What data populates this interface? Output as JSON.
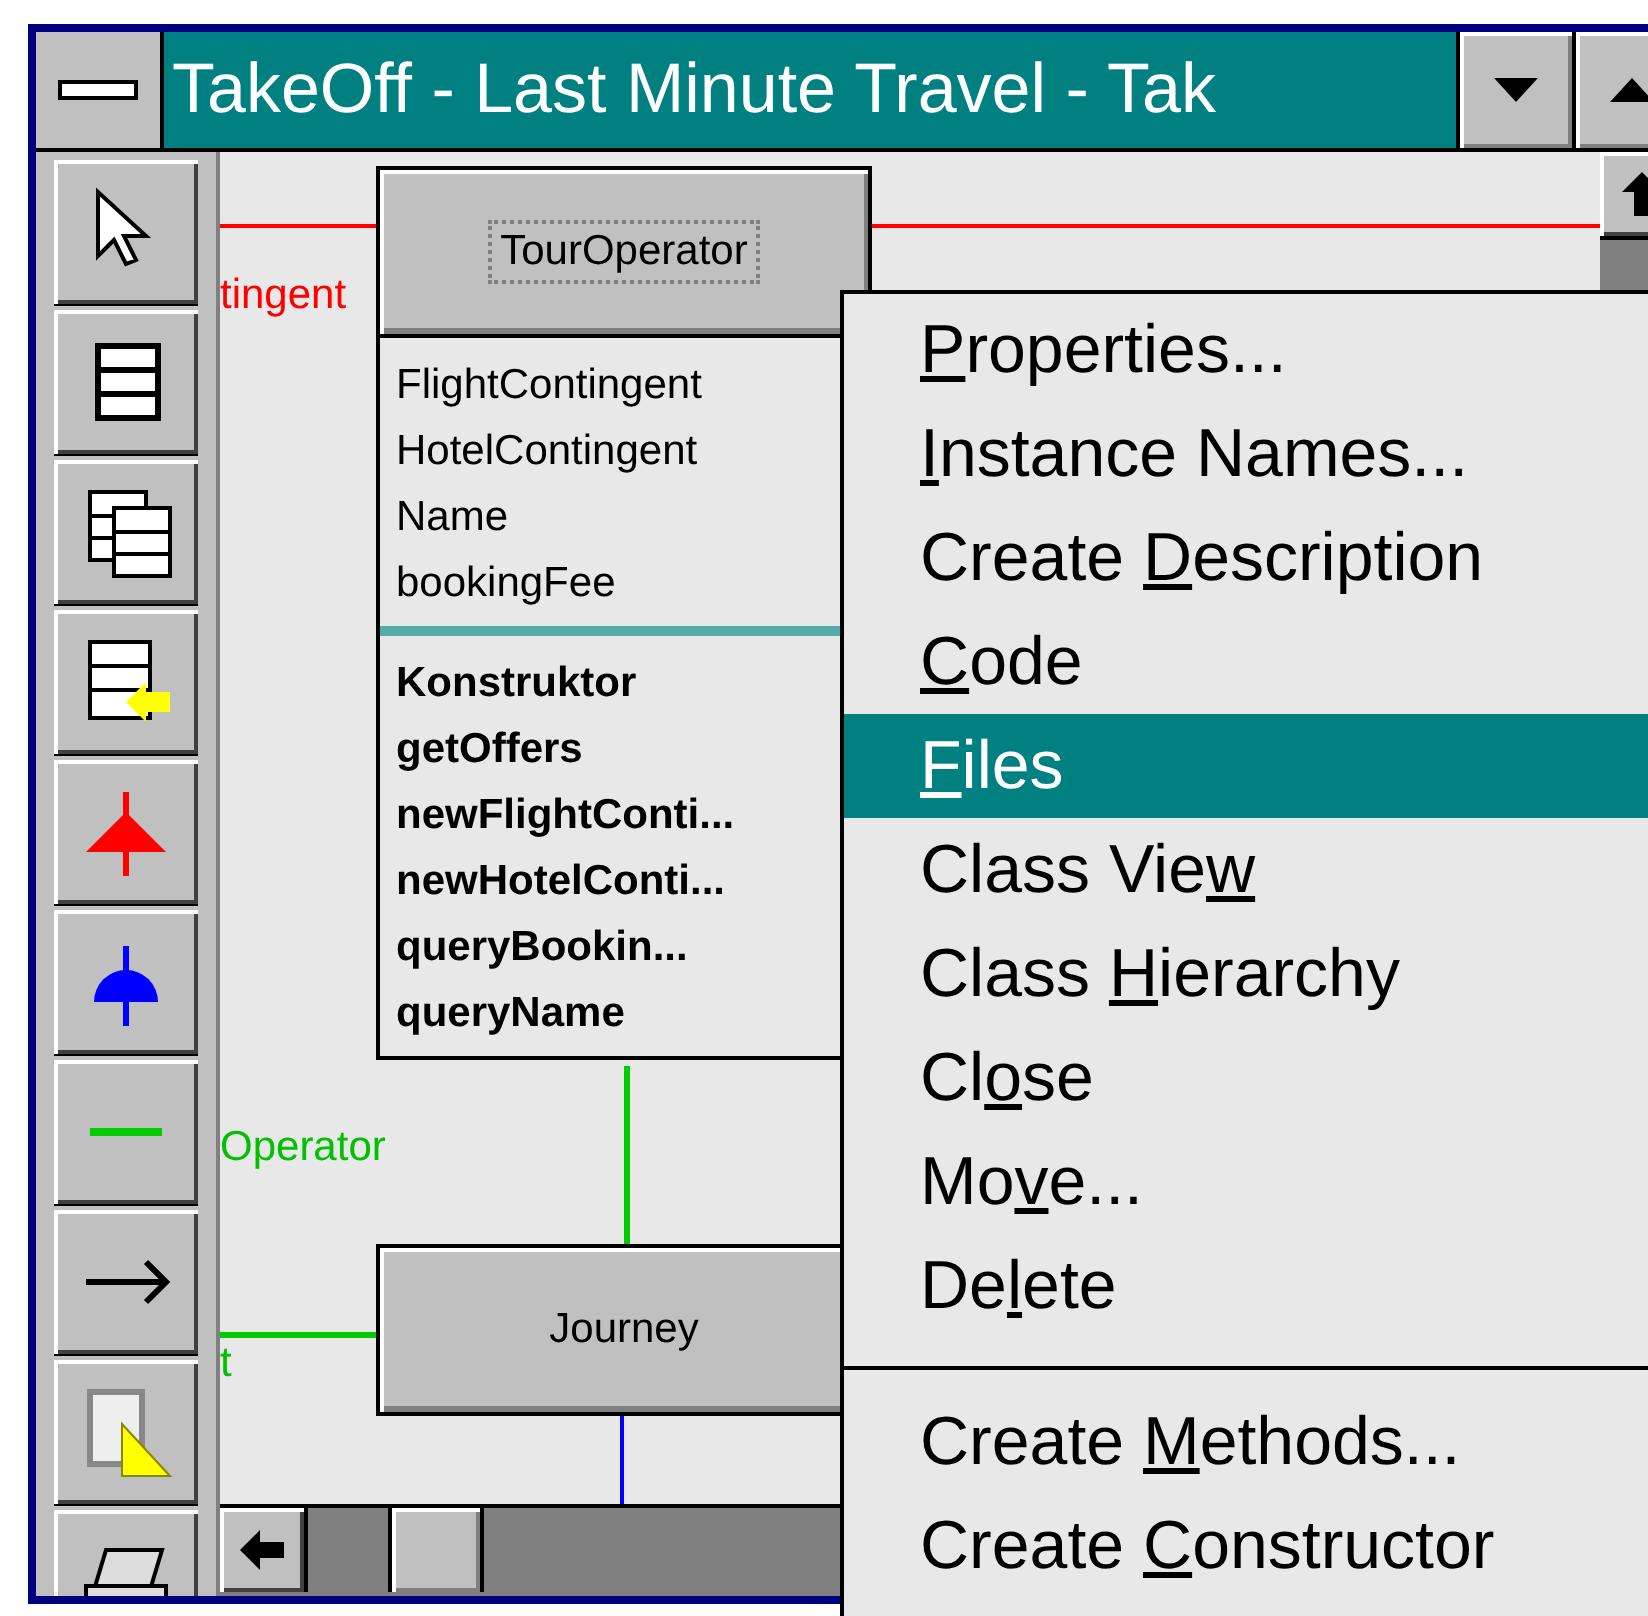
{
  "window": {
    "title": "TakeOff - Last Minute Travel - Tak"
  },
  "diagram": {
    "labels": [
      {
        "text": "tingent",
        "color": "#ff0000",
        "kind": "top"
      },
      {
        "text": "Operator",
        "color": "#00c000",
        "kind": "middle"
      },
      {
        "text": "t",
        "color": "#00c000",
        "kind": "bottom"
      }
    ],
    "classes": [
      {
        "name": "TourOperator",
        "focused": true,
        "attributes": [
          "FlightContingent",
          "HotelContingent",
          "Name",
          "bookingFee"
        ],
        "methods": [
          "Konstruktor",
          "getOffers",
          "newFlightConti...",
          "newHotelConti...",
          "queryBookin...",
          "queryName"
        ]
      },
      {
        "name": "Journey",
        "focused": false
      }
    ]
  },
  "context_menu": {
    "items": [
      {
        "kind": "item",
        "key": "P",
        "post": "roperties...",
        "selected": false
      },
      {
        "kind": "item",
        "key": "I",
        "post": "nstance Names...",
        "selected": false
      },
      {
        "kind": "item",
        "pre": "Create ",
        "key": "D",
        "post": "escription",
        "selected": false
      },
      {
        "kind": "item",
        "key": "C",
        "post": "ode",
        "selected": false
      },
      {
        "kind": "item",
        "key": "F",
        "post": "iles",
        "selected": true
      },
      {
        "kind": "item",
        "pre": "Class Vie",
        "key": "w",
        "selected": false
      },
      {
        "kind": "item",
        "pre": "Class ",
        "key": "H",
        "post": "ierarchy",
        "selected": false
      },
      {
        "kind": "item",
        "pre": "Cl",
        "key": "o",
        "post": "se",
        "selected": false
      },
      {
        "kind": "item",
        "pre": "Mo",
        "key": "v",
        "post": "e...",
        "selected": false
      },
      {
        "kind": "item",
        "pre": "De",
        "key": "l",
        "post": "ete",
        "selected": false
      },
      {
        "kind": "separator"
      },
      {
        "kind": "item",
        "pre": "Create ",
        "key": "M",
        "post": "ethods...",
        "selected": false
      },
      {
        "kind": "item",
        "pre": "Create ",
        "key": "C",
        "post": "onstructor",
        "selected": false
      }
    ]
  }
}
